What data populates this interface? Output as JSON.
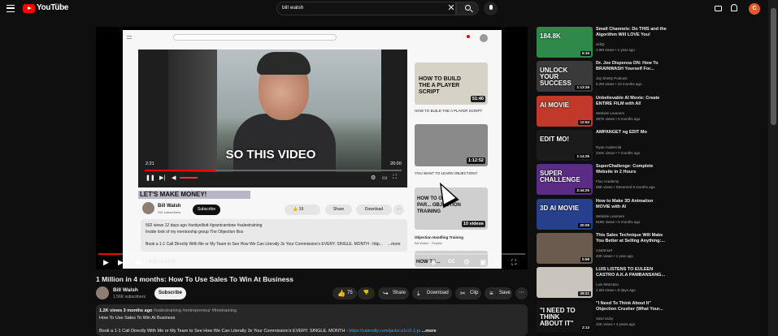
{
  "masthead": {
    "logo_text": "YouTube",
    "region": "PH",
    "search_value": "bill walsh",
    "avatar_letter": "C",
    "icons": [
      "menu-icon",
      "clear-icon",
      "search-icon",
      "mic-icon",
      "create-icon",
      "bell-icon"
    ],
    "accent_color": "#ff0000"
  },
  "player": {
    "caption": "SO THIS VIDEO",
    "time_display": "0:02 / 1:17:27",
    "progress_fraction": 0.05,
    "inner": {
      "time_left": "2:21",
      "time_right": "20:00",
      "title_bar": "LET'S MAKE MONEY!",
      "channel": "Bill Walsh",
      "subscribers": "761 subscribers",
      "subscribe": "Subscribe",
      "likes": "19",
      "share": "Share",
      "download": "Download",
      "desc_meta": "592 views  12 days ago  #andyelliott #grantcardone #salestraining",
      "desc_line1": "Inside look of my mentorship group The Objection Box",
      "desc_line2": "Book a 1-1 Call Directly With Me or My Team to See How We Can Literally 3x Your Commission's EVERY. SINGLE. MONTH - http...",
      "desc_more": "...more",
      "side": [
        {
          "thumb_text": "HOW TO BUILD THE A PLAYER SCRIPT",
          "duration": "51:40",
          "title": "HOW TO BUILD THE A PLAYER SCRIPT"
        },
        {
          "thumb_text": "",
          "duration": "1:12:52",
          "title": "YOU WANT TO LEARN OBJECTION?"
        },
        {
          "thumb_text": "HOW TO GET A PAR... OBJECTION TRAINING",
          "duration": "10 videos",
          "title": "Objection Handling Training",
          "sub": "Bill Walsh · Playlist"
        },
        {
          "thumb_text": "HOW TO...",
          "duration": "",
          "title": ""
        }
      ]
    }
  },
  "video": {
    "title": "1 Million in 4 months: How To Use Sales To Win At Business",
    "channel": "Bill Walsh",
    "subscribers": "1.56K subscribers",
    "subscribe": "Subscribe",
    "likes": "75",
    "share": "Share",
    "download": "Download",
    "clip": "Clip",
    "save": "Save",
    "description": {
      "meta": "1.2K views  3 months ago",
      "hashtags": "#salestraining #entrepreneur #freetraining",
      "line1": "How To Use Sales To Win At Business",
      "line2": "Book a 1-1 Call Directly With Me or My Team to See How We Can Literally 3x Your Commission's EVERY. SINGLE. MONTH - ",
      "link": "https://calendly.com/jacks-z1c/1-1-js",
      "more": "...more"
    }
  },
  "recommendations": [
    {
      "title": "Small Channels: Do THIS and the Algorithm Will LOVE You!",
      "channel": "vidIQ",
      "meta": "3.9M views • 1 year ago",
      "duration": "5:15",
      "thumb_text": "184.8K",
      "bg": "#2f8a4a"
    },
    {
      "title": "Dr. Joe Dispenza ON: How To BRAINWASH Yourself For...",
      "channel": "Jay Shetty Podcast",
      "meta": "5.2M views • 10 months ago",
      "duration": "1:13:26",
      "thumb_text": "UNLOCK YOUR SUCCESS",
      "bg": "#3a3a3a"
    },
    {
      "title": "Unbelievable AI Movie: Create ENTIRE FILM with AI!",
      "channel": "Website Learners",
      "meta": "387K views • 5 months ago",
      "duration": "12:54",
      "thumb_text": "AI MOVIE",
      "bg": "#c0392b"
    },
    {
      "title": "AMPANGET ng EDIT Mo",
      "channel": "Ryan Audencial",
      "meta": "234K views • 7 months ago",
      "duration": "1:14:25",
      "thumb_text": "EDIT MO!",
      "bg": "#1b1b1b"
    },
    {
      "title": "SuperChallenge: Complete Website in 2 Hours",
      "channel": "Flux Academy",
      "meta": "69K views • Streamed 9 months ago",
      "duration": "2:44:25",
      "thumb_text": "SUPER CHALLENGE",
      "bg": "#5b2c83"
    },
    {
      "title": "How to Make 3D Animation MOVIE with AI",
      "channel": "Website Learners",
      "meta": "818K views • 5 months ago",
      "duration": "20:09",
      "thumb_text": "3D AI MOVIE",
      "bg": "#27408b"
    },
    {
      "title": "This Sales Technique Will Make You Better at Selling Anything:...",
      "channel": "AJ&Smart",
      "meta": "42K views • 1 year ago",
      "duration": "0:59",
      "thumb_text": "",
      "bg": "#6b5a4e"
    },
    {
      "title": "LUIS LISTENS TO EULEEN CASTRO A.K.A PAMBANSANG...",
      "channel": "Luis Manzano",
      "meta": "2.5M views • 8 days ago",
      "duration": "29:21",
      "thumb_text": "",
      "bg": "#c9c4be"
    },
    {
      "title": "\"I Need To Think About It\" Objection Crusher (What Your...",
      "channel": "Salvi Suby",
      "meta": "42K views • 4 years ago",
      "duration": "2:13",
      "thumb_text": "\"I NEED TO THINK ABOUT IT\"",
      "bg": "#141414"
    }
  ]
}
